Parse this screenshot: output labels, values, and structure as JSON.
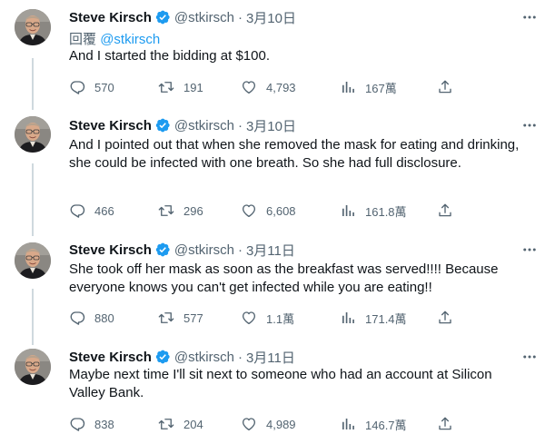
{
  "tweets": [
    {
      "name": "Steve Kirsch",
      "handle": "@stkirsch",
      "separator": "·",
      "date": "3月10日",
      "replying_label": "回覆",
      "replying_to": "@stkirsch",
      "text": "And I started the bidding at $100.",
      "replies": "570",
      "retweets": "191",
      "likes": "4,793",
      "views": "167萬"
    },
    {
      "name": "Steve Kirsch",
      "handle": "@stkirsch",
      "separator": "·",
      "date": "3月10日",
      "text": "And I pointed out that when she removed the mask for eating and drinking, she could be infected with one breath. So she had full disclosure.",
      "replies": "466",
      "retweets": "296",
      "likes": "6,608",
      "views": "161.8萬"
    },
    {
      "name": "Steve Kirsch",
      "handle": "@stkirsch",
      "separator": "·",
      "date": "3月11日",
      "text": "She took off her mask as soon as the breakfast was served!!!! Because everyone knows you can't get infected while you are eating!!",
      "replies": "880",
      "retweets": "577",
      "likes": "1.1萬",
      "views": "171.4萬"
    },
    {
      "name": "Steve Kirsch",
      "handle": "@stkirsch",
      "separator": "·",
      "date": "3月11日",
      "text": "Maybe next time I'll sit next to someone who had an account at Silicon Valley Bank.",
      "replies": "838",
      "retweets": "204",
      "likes": "4,989",
      "views": "146.7萬"
    }
  ],
  "icons": {
    "verified": "verified-badge-icon",
    "more": "more-icon",
    "reply": "reply-icon",
    "retweet": "retweet-icon",
    "like": "heart-icon",
    "views": "views-chart-icon",
    "share": "share-icon"
  },
  "colors": {
    "accent": "#1d9bf0",
    "secondary_text": "#536471",
    "thread_line": "#cfd9de"
  }
}
